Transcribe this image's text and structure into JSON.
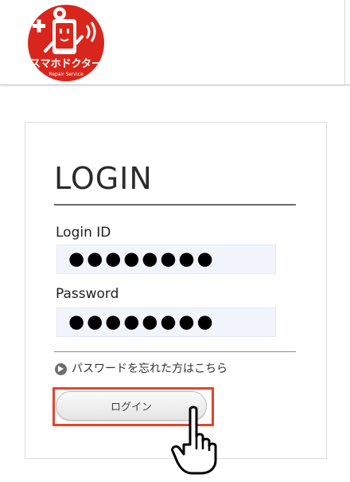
{
  "header": {
    "logo": {
      "brand_text": "スマホドクター",
      "sub_text": "Repair Service",
      "color": "#d9261c"
    }
  },
  "login": {
    "title": "LOGIN",
    "id_label": "Login ID",
    "id_value": "●●●●●●●●",
    "password_label": "Password",
    "password_value": "●●●●●●●●",
    "forgot_link": "パスワードを忘れた方はこちら",
    "submit_label": "ログイン"
  },
  "annotations": {
    "highlight_color": "#e1462a",
    "cursor_icon": "hand-pointer-icon"
  }
}
